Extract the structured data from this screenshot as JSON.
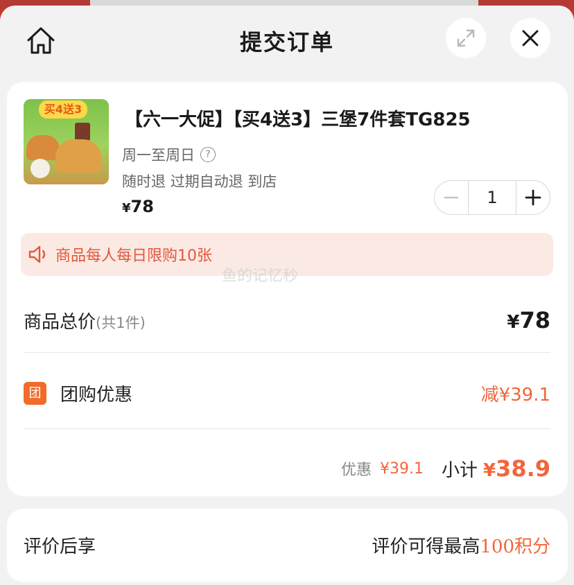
{
  "header": {
    "title": "提交订单",
    "icons": {
      "home": "home-icon",
      "expand": "expand-icon",
      "close": "close-icon"
    }
  },
  "product": {
    "image_badge": "买4送3",
    "name": "【六一大促】【买4送3】三堡7件套TG825",
    "days": "周一至周日",
    "refund": "随时退 过期自动退 到店",
    "price_symbol": "¥",
    "price": "78",
    "quantity": "1"
  },
  "notice": {
    "text": "商品每人每日限购10张",
    "icon": "speaker-icon"
  },
  "watermark": "鱼的记忆秒",
  "summary": {
    "total_label": "商品总价",
    "total_count": "(共1件)",
    "total_symbol": "¥",
    "total_value": "78",
    "group_icon_char": "团",
    "group_label": "团购优惠",
    "group_value": "减¥39.1",
    "discount_label": "优惠",
    "discount_value": "¥39.1",
    "subtotal_label": "小计",
    "subtotal_symbol": "¥",
    "subtotal_value": "38.9"
  },
  "review": {
    "label": "评价后享",
    "value_prefix": "评价可得最高",
    "value_highlight": "100积分"
  },
  "colors": {
    "accent": "#f2653a",
    "notice_bg": "#fbe9e4",
    "group_icon_bg": "#f26b2b"
  }
}
